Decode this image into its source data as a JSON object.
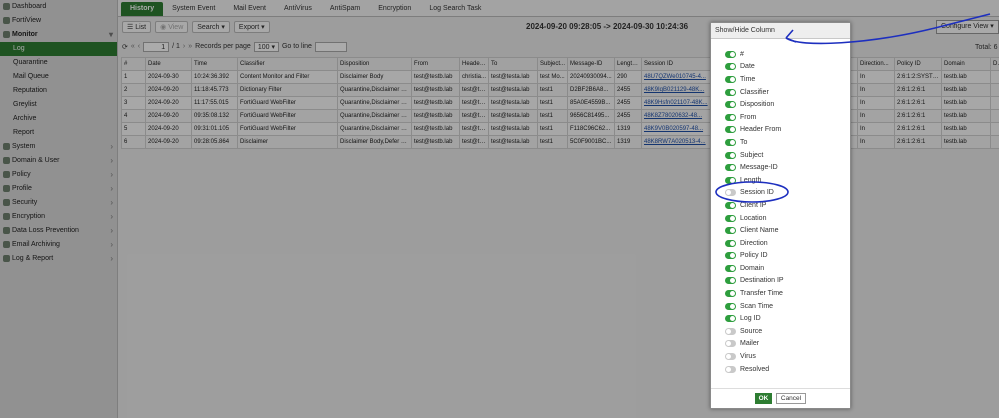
{
  "sidebar": {
    "items": [
      {
        "label": "Dashboard",
        "icon": "dashboard-icon"
      },
      {
        "label": "FortiView",
        "icon": "fortiview-icon"
      },
      {
        "label": "Monitor",
        "icon": "monitor-icon"
      },
      {
        "label": "Log"
      },
      {
        "label": "Quarantine"
      },
      {
        "label": "Mail Queue"
      },
      {
        "label": "Reputation"
      },
      {
        "label": "Greylist"
      },
      {
        "label": "Archive"
      },
      {
        "label": "Report"
      },
      {
        "label": "System",
        "icon": "system-icon"
      },
      {
        "label": "Domain & User",
        "icon": "domain-user-icon"
      },
      {
        "label": "Policy",
        "icon": "policy-icon"
      },
      {
        "label": "Profile",
        "icon": "profile-icon"
      },
      {
        "label": "Security",
        "icon": "security-icon"
      },
      {
        "label": "Encryption",
        "icon": "encryption-icon"
      },
      {
        "label": "Data Loss Prevention",
        "icon": "dlp-icon"
      },
      {
        "label": "Email Archiving",
        "icon": "email-archiving-icon"
      },
      {
        "label": "Log & Report",
        "icon": "log-report-icon"
      }
    ]
  },
  "tabs": [
    "History",
    "System Event",
    "Mail Event",
    "AntiVirus",
    "AntiSpam",
    "Encryption",
    "Log Search Task"
  ],
  "toolbar": {
    "list_label": "List",
    "view_label": "View",
    "search_label": "Search",
    "export_label": "Export",
    "date_range": "2024-09-20 09:28:05 -> 2024-09-30 10:24:36",
    "configure_view_label": "Configure View"
  },
  "pager": {
    "page_value": "1",
    "page_total": "/ 1",
    "records_label": "Records per page",
    "records_value": "100",
    "goto_label": "Go to line"
  },
  "total_label": "Total: 6",
  "table": {
    "columns": [
      "#",
      "Date",
      "Time",
      "Classifier",
      "Disposition",
      "From",
      "Header ...",
      "To",
      "Subject...",
      "Message-ID",
      "Length ...",
      "Session ID",
      "",
      "Direction...",
      "Policy ID",
      "Domain",
      "De"
    ],
    "rows": [
      [
        "1",
        "2024-09-30",
        "10:24:36.392",
        "Content Monitor and Filter",
        "Disclaimer Body",
        "test@testb.lab",
        "christia...",
        "test@testa.lab",
        "test Mo...",
        "20240930094...",
        "290",
        "48U7QZWe010745-4...",
        "",
        "In",
        "2:6:1:2:SYSTEM",
        "testb.lab",
        ""
      ],
      [
        "2",
        "2024-09-20",
        "11:18:45.773",
        "Dictionary Filter",
        "Quarantine,Disclaimer B...",
        "test@testb.lab",
        "test@te...",
        "test@testa.lab",
        "test1",
        "D2BF2B6A8...",
        "2455",
        "48K9IqB021129-48K...",
        "",
        "In",
        "2:6:1:2:6:1",
        "testb.lab",
        ""
      ],
      [
        "3",
        "2024-09-20",
        "11:17:55.015",
        "FortiGuard WebFilter",
        "Quarantine,Disclaimer B...",
        "test@testb.lab",
        "test@te...",
        "test@testa.lab",
        "test1",
        "85A0E4559B...",
        "2455",
        "48K9Hsfn021107-48K...",
        "",
        "In",
        "2:6:1:2:6:1",
        "testb.lab",
        ""
      ],
      [
        "4",
        "2024-09-20",
        "09:35:08.132",
        "FortiGuard WebFilter",
        "Quarantine,Disclaimer B...",
        "test@testb.lab",
        "test@te...",
        "test@testa.lab",
        "test1",
        "9656C81495...",
        "2455",
        "48K8Z78020632-48...",
        "",
        "In",
        "2:6:1:2:6:1",
        "testb.lab",
        ""
      ],
      [
        "5",
        "2024-09-20",
        "09:31:01.105",
        "FortiGuard WebFilter",
        "Quarantine,Disclaimer B...",
        "test@testb.lab",
        "test@te...",
        "test@testa.lab",
        "test1",
        "F118C96C62...",
        "1319",
        "48K9V0B020597-48...",
        "",
        "In",
        "2:6:1:2:6:1",
        "testb.lab",
        ""
      ],
      [
        "6",
        "2024-09-20",
        "09:28:05.864",
        "Disclaimer",
        "Disclaimer Body,Defer D...",
        "test@testb.lab",
        "test@te...",
        "test@testa.lab",
        "test1",
        "5C0F9001BC...",
        "1319",
        "48K8RW7A020513-4...",
        "",
        "In",
        "2:6:1:2:6:1",
        "testb.lab",
        ""
      ]
    ]
  },
  "dialog": {
    "title": "Show/Hide Column",
    "columns": [
      {
        "label": "#",
        "on": true
      },
      {
        "label": "Date",
        "on": true
      },
      {
        "label": "Time",
        "on": true
      },
      {
        "label": "Classifier",
        "on": true
      },
      {
        "label": "Disposition",
        "on": true
      },
      {
        "label": "From",
        "on": true
      },
      {
        "label": "Header From",
        "on": true
      },
      {
        "label": "To",
        "on": true
      },
      {
        "label": "Subject",
        "on": true
      },
      {
        "label": "Message-ID",
        "on": true
      },
      {
        "label": "Length",
        "on": true
      },
      {
        "label": "Session ID",
        "on": false
      },
      {
        "label": "Client IP",
        "on": true
      },
      {
        "label": "Location",
        "on": true
      },
      {
        "label": "Client Name",
        "on": true
      },
      {
        "label": "Direction",
        "on": true
      },
      {
        "label": "Policy ID",
        "on": true
      },
      {
        "label": "Domain",
        "on": true
      },
      {
        "label": "Destination IP",
        "on": true
      },
      {
        "label": "Transfer Time",
        "on": true
      },
      {
        "label": "Scan Time",
        "on": true
      },
      {
        "label": "Log ID",
        "on": true
      },
      {
        "label": "Source",
        "on": false
      },
      {
        "label": "Mailer",
        "on": false
      },
      {
        "label": "Virus",
        "on": false
      },
      {
        "label": "Resolved",
        "on": false
      }
    ],
    "ok_label": "OK",
    "cancel_label": "Cancel"
  },
  "colors": {
    "accent": "#2e7d32",
    "annotation": "#1d2fbf",
    "link": "#1f4fa8"
  }
}
